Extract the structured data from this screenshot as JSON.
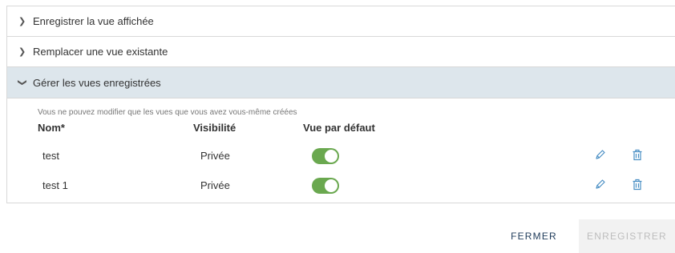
{
  "accordion": {
    "sections": [
      {
        "label": "Enregistrer la vue affichée",
        "state": "collapsed",
        "chevron_icon": "chevron-right-icon"
      },
      {
        "label": "Remplacer une vue existante",
        "state": "collapsed",
        "chevron_icon": "chevron-right-icon"
      },
      {
        "label": "Gérer les vues enregistrées",
        "state": "expanded",
        "chevron_icon": "chevron-down-icon"
      }
    ]
  },
  "manage": {
    "hint": "Vous ne pouvez modifier que les vues que vous avez vous-même créées",
    "columns": {
      "name": "Nom*",
      "visibility": "Visibilité",
      "default": "Vue par défaut"
    },
    "rows": [
      {
        "name": "test",
        "visibility": "Privée",
        "default_on": true
      },
      {
        "name": "test 1",
        "visibility": "Privée",
        "default_on": true
      }
    ],
    "row_icons": [
      "pencil-icon",
      "trash-icon"
    ]
  },
  "footer": {
    "close_label": "FERMER",
    "save_label": "ENREGISTRER"
  },
  "colors": {
    "toggle_on": "#6aa84f",
    "expanded_header_bg": "#dde6ec",
    "icon_blue": "#4a8fc4",
    "close_text": "#1f3b5a",
    "disabled_bg": "#f2f2f2",
    "disabled_text": "#bdbdbd"
  }
}
